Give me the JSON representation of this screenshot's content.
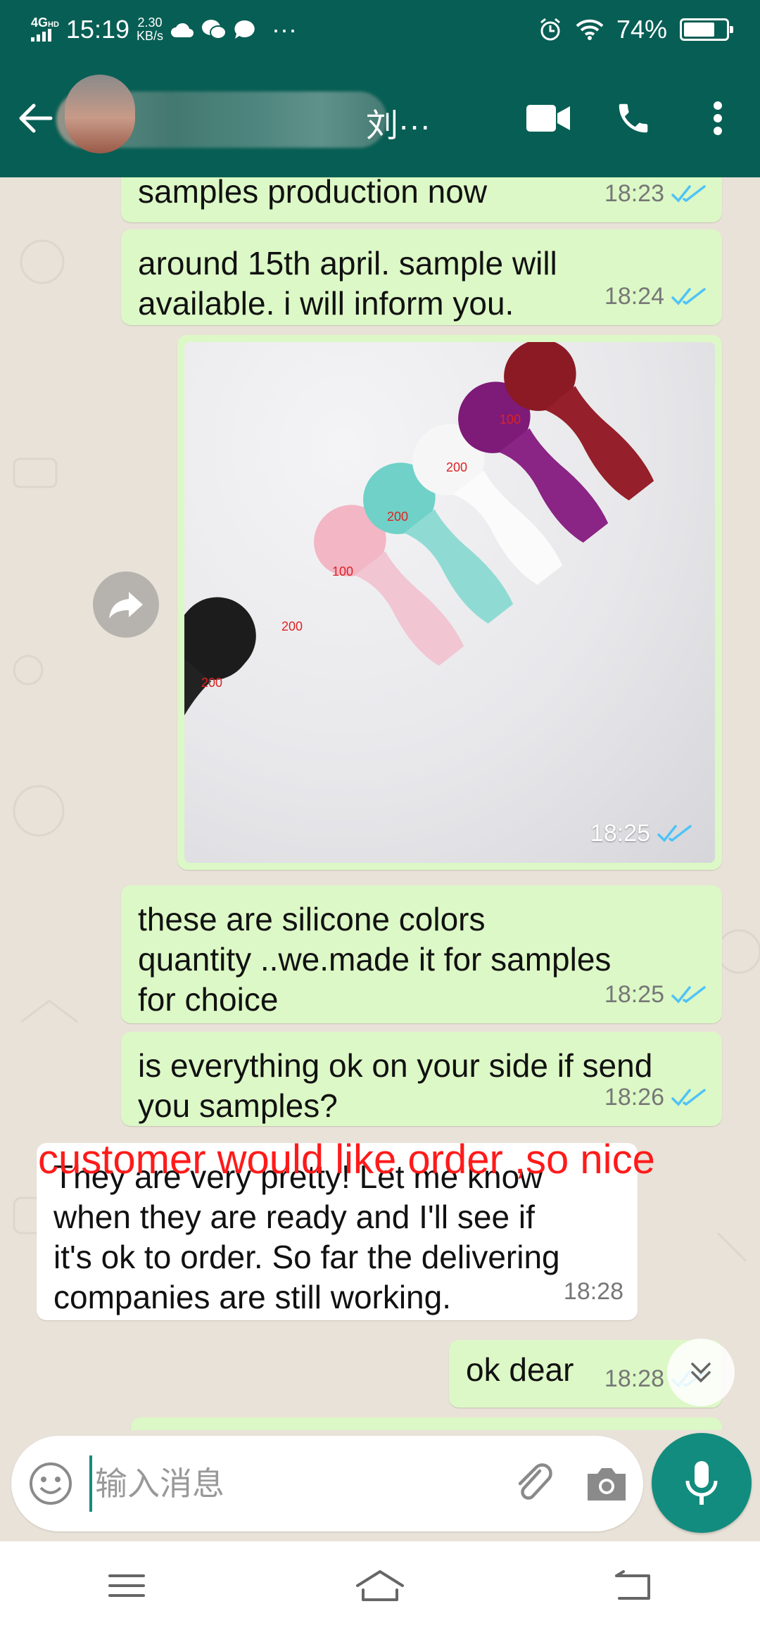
{
  "status_bar": {
    "network": "4G",
    "network_tag": "HD",
    "time": "15:19",
    "speed_value": "2.30",
    "speed_unit": "KB/s",
    "more": "···",
    "battery_percent": "74%",
    "battery_level": 0.74
  },
  "header": {
    "contact_tail": "刘···"
  },
  "messages": [
    {
      "text": "samples production now",
      "time": "18:23",
      "direction": "out"
    },
    {
      "text": "around 15th april. sample will\navailable. i will inform you.",
      "time": "18:24",
      "direction": "out"
    },
    {
      "type": "image",
      "time": "18:25",
      "direction": "out",
      "photo_labels": [
        "100",
        "200",
        "200",
        "100",
        "200",
        "200"
      ]
    },
    {
      "text": "these are silicone colors\nquantity ..we.made it for samples\nfor choice",
      "time": "18:25",
      "direction": "out"
    },
    {
      "text": "is everything ok on your side if send\nyou samples?",
      "time": "18:26",
      "direction": "out"
    },
    {
      "text": "They are very pretty! Let me know\nwhen they are ready and I'll see if\nit's ok to order. So far the delivering\ncompanies are still working.",
      "time": "18:28",
      "direction": "in"
    },
    {
      "text": "ok dear",
      "time": "18:28",
      "direction": "out"
    }
  ],
  "annotation": "customer would like order ,so nice",
  "input": {
    "placeholder": "输入消息"
  },
  "colors": {
    "header": "#075e54",
    "outgoing_bubble": "#dcf8c6",
    "incoming_bubble": "#ffffff",
    "accent": "#128c7e",
    "read_ticks": "#4fc3f7",
    "annotation": "#ff1a1a"
  },
  "icons": {
    "back": "arrow-left-icon",
    "video": "video-camera-icon",
    "call": "phone-icon",
    "menu": "more-vertical-icon",
    "forward": "forward-icon",
    "emoji": "smiley-icon",
    "attach": "paperclip-icon",
    "camera": "camera-icon",
    "mic": "microphone-icon",
    "scroll": "double-chevron-down-icon"
  }
}
